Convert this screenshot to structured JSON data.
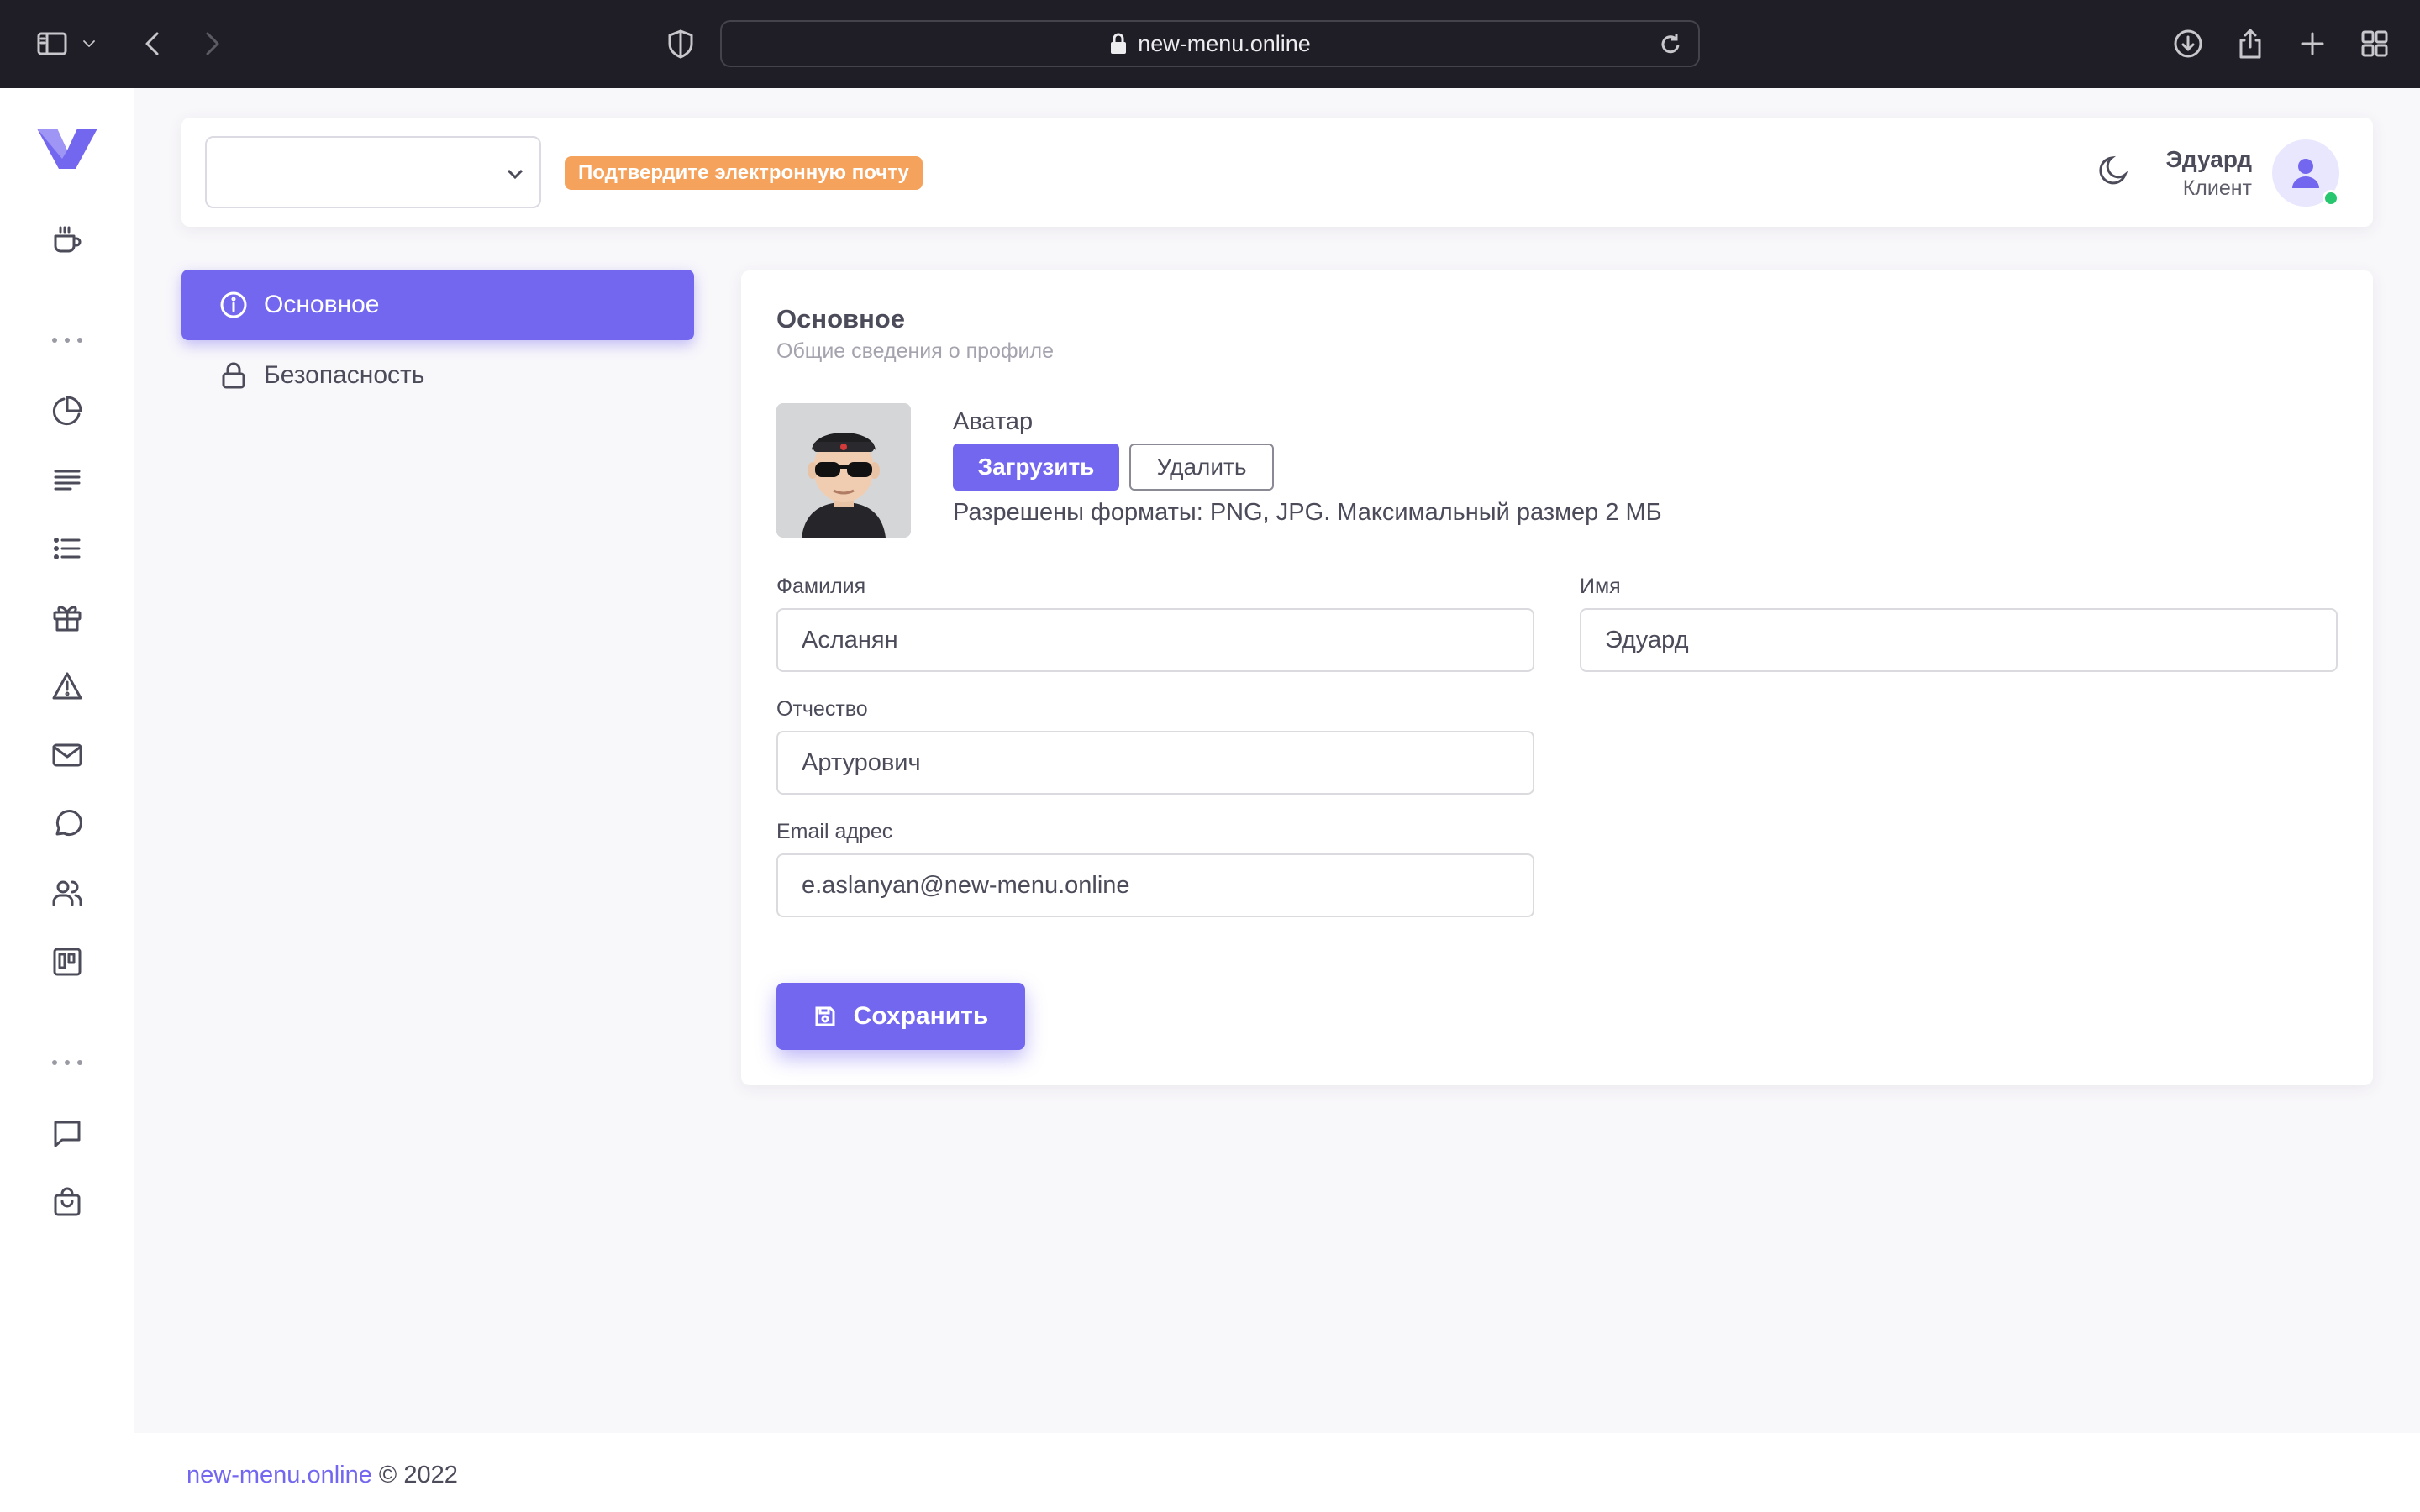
{
  "browser": {
    "url": "new-menu.online"
  },
  "header": {
    "select_value": "",
    "notice": "Подтвердите электронную почту",
    "user_name": "Эдуард",
    "user_role": "Клиент"
  },
  "settings_nav": {
    "items": [
      {
        "label": "Основное",
        "active": true
      },
      {
        "label": "Безопасность",
        "active": false
      }
    ]
  },
  "profile": {
    "title": "Основное",
    "subtitle": "Общие сведения о профиле",
    "avatar_label": "Аватар",
    "upload_label": "Загрузить",
    "delete_label": "Удалить",
    "formats_hint": "Разрешены форматы: PNG, JPG. Максимальный размер 2 МБ",
    "fields": {
      "last_name": {
        "label": "Фамилия",
        "value": "Асланян"
      },
      "first_name": {
        "label": "Имя",
        "value": "Эдуард"
      },
      "middle_name": {
        "label": "Отчество",
        "value": "Артурович"
      },
      "email": {
        "label": "Email адрес",
        "value": "e.aslanyan@new-menu.online"
      }
    },
    "save_label": "Сохранить"
  },
  "footer": {
    "link": "new-menu.online",
    "copyright": " © 2022"
  },
  "colors": {
    "primary": "#7367f0",
    "warning": "#f5a35c",
    "success": "#28c76f"
  }
}
